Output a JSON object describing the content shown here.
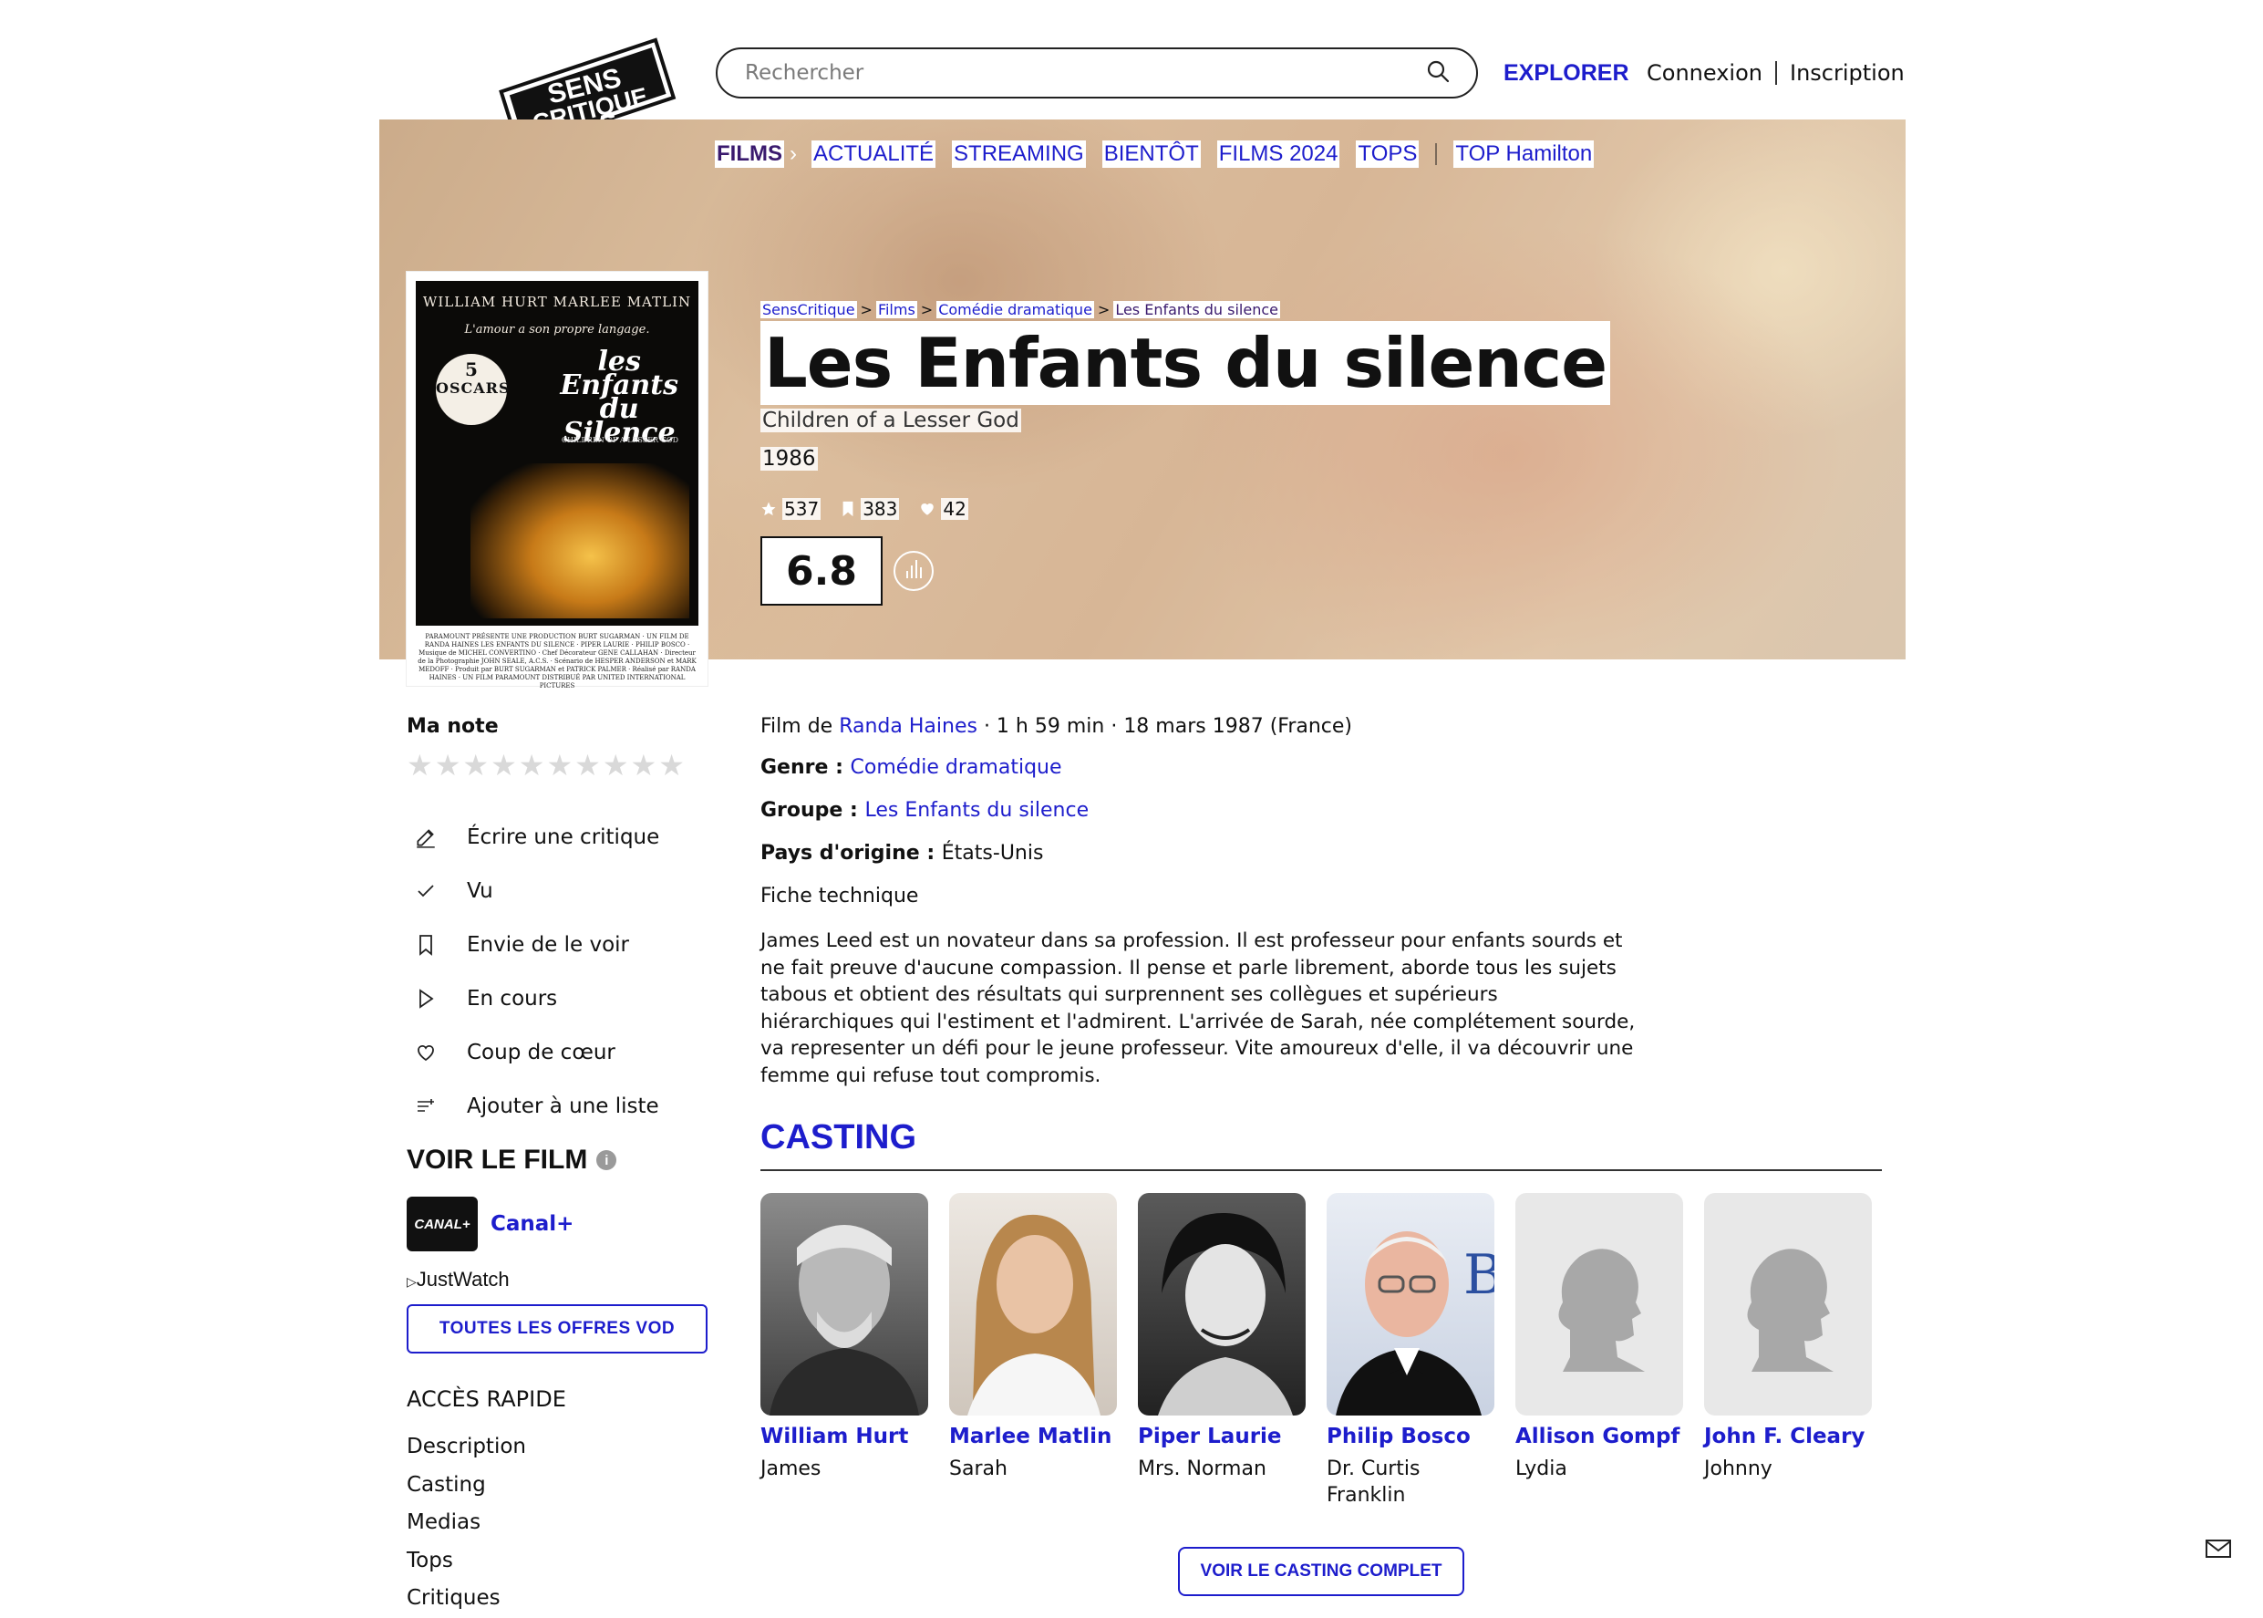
{
  "header": {
    "logo_line1": "SENS",
    "logo_line2": "CRITIQUE",
    "search_placeholder": "Rechercher",
    "explore": "EXPLORER",
    "login": "Connexion",
    "signup": "Inscription"
  },
  "nav": {
    "films": "FILMS",
    "chevron": "›",
    "items": [
      "ACTUALITÉ",
      "STREAMING",
      "BIENTÔT",
      "FILMS 2024",
      "TOPS"
    ],
    "top_hamilton": "TOP Hamilton"
  },
  "breadcrumb": {
    "items": [
      "SensCritique",
      "Films",
      "Comédie dramatique",
      "Les Enfants du silence"
    ],
    "separator": ">"
  },
  "movie": {
    "title": "Les Enfants du silence",
    "original_title": "Children of a Lesser God",
    "year": "1986",
    "ratings_count": "537",
    "wishlist_count": "383",
    "favorites_count": "42",
    "score": "6.8"
  },
  "poster": {
    "actors": "WILLIAM HURT    MARLEE MATLIN",
    "tagline": "L'amour a son propre langage.",
    "title_line1": "les",
    "title_line2": "Enfants",
    "title_line3": "du",
    "title_line4": "Silence",
    "subtitle": "CHILDREN OF A LESSER GOD",
    "oscar_count": "5",
    "oscar_label": "OSCARS",
    "credits": "PARAMOUNT PRÉSENTE UNE PRODUCTION BURT SUGARMAN · UN FILM DE RANDA HAINES LES ENFANTS DU SILENCE · PIPER LAURIE · PHILIP BOSCO · Musique de MICHEL CONVERTINO · Chef Décorateur GENE CALLAHAN · Directeur de la Photographie JOHN SEALE, A.C.S. · Scénario de HESPER ANDERSON et MARK MEDOFF · Produit par BURT SUGARMAN et PATRICK PALMER · Réalisé par RANDA HAINES · UN FILM PARAMOUNT DISTRIBUÉ PAR UNITED INTERNATIONAL PICTURES",
    "dash": "-"
  },
  "sidebar": {
    "my_rating_label": "Ma note",
    "star_count": 10,
    "actions": [
      {
        "icon": "pencil-icon",
        "label": "Écrire une critique"
      },
      {
        "icon": "check-icon",
        "label": "Vu"
      },
      {
        "icon": "bookmark-icon",
        "label": "Envie de le voir"
      },
      {
        "icon": "play-icon",
        "label": "En cours"
      },
      {
        "icon": "heart-icon",
        "label": "Coup de cœur"
      },
      {
        "icon": "add-list-icon",
        "label": "Ajouter à une liste"
      }
    ],
    "watch_title": "VOIR LE FILM",
    "info_glyph": "i",
    "provider_logo": "CANAL+",
    "provider_name": "Canal+",
    "justwatch": "JustWatch",
    "vod_button": "TOUTES LES OFFRES VOD",
    "quick_access_title": "ACCÈS RAPIDE",
    "quick_links": [
      "Description",
      "Casting",
      "Medias",
      "Tops",
      "Critiques"
    ]
  },
  "details": {
    "film_by_prefix": "Film de ",
    "director": "Randa Haines",
    "duration_release": " · 1 h 59 min · 18 mars 1987 (France)",
    "genre_label": "Genre : ",
    "genre": "Comédie dramatique",
    "group_label": "Groupe : ",
    "group": "Les Enfants du silence",
    "country_label": "Pays d'origine : ",
    "country": "États-Unis",
    "tech_sheet": "Fiche technique",
    "synopsis": "James Leed est un novateur dans sa profession. Il est professeur pour enfants sourds et ne fait preuve d'aucune compassion. Il pense et parle librement, aborde tous les sujets tabous et obtient des résultats qui surprennent ses collègues et supérieurs hiérarchiques qui l'estiment et l'admirent. L'arrivée de Sarah, née complétement sourde, va representer un défi pour le jeune professeur. Vite amoureux d'elle, il va découvrir une femme qui refuse tout compromis."
  },
  "casting": {
    "title": "CASTING",
    "cast": [
      {
        "name": "William Hurt",
        "role": "James"
      },
      {
        "name": "Marlee Matlin",
        "role": "Sarah"
      },
      {
        "name": "Piper Laurie",
        "role": "Mrs. Norman"
      },
      {
        "name": "Philip Bosco",
        "role": "Dr. Curtis Franklin"
      },
      {
        "name": "Allison Gompf",
        "role": "Lydia"
      },
      {
        "name": "John F. Cleary",
        "role": "Johnny"
      }
    ],
    "full_cast_button": "VOIR LE CASTING COMPLET"
  }
}
